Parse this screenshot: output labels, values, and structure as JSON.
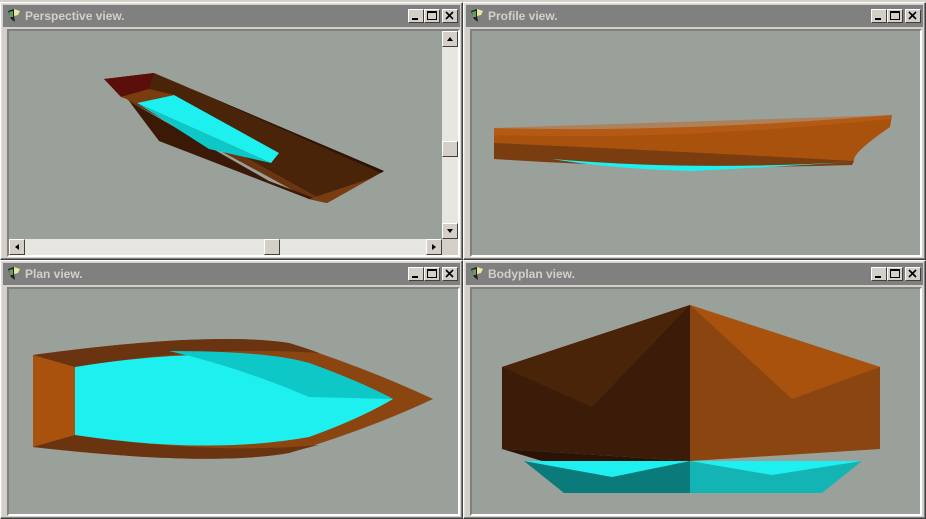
{
  "windows": {
    "perspective": {
      "title": "Perspective view."
    },
    "profile": {
      "title": "Profile view."
    },
    "plan": {
      "title": "Plan view."
    },
    "bodyplan": {
      "title": "Bodyplan view."
    }
  },
  "scrollbars": {
    "perspective_vertical_position": 0.58,
    "perspective_horizontal_position": 0.6
  },
  "colors": {
    "hull_dark": "#3a1c08",
    "hull_mid": "#7a3d10",
    "hull_light": "#a8520e",
    "hull_stern": "#5a0f0a",
    "interior": "#1ef0f0",
    "interior_dark": "#0a7a7a",
    "viewport_bg": "#9aa09a",
    "inactive_title": "#808080"
  },
  "icons": {
    "window_icon": "app-icon",
    "minimize": "minimize-icon",
    "maximize": "maximize-icon",
    "close": "close-icon"
  }
}
